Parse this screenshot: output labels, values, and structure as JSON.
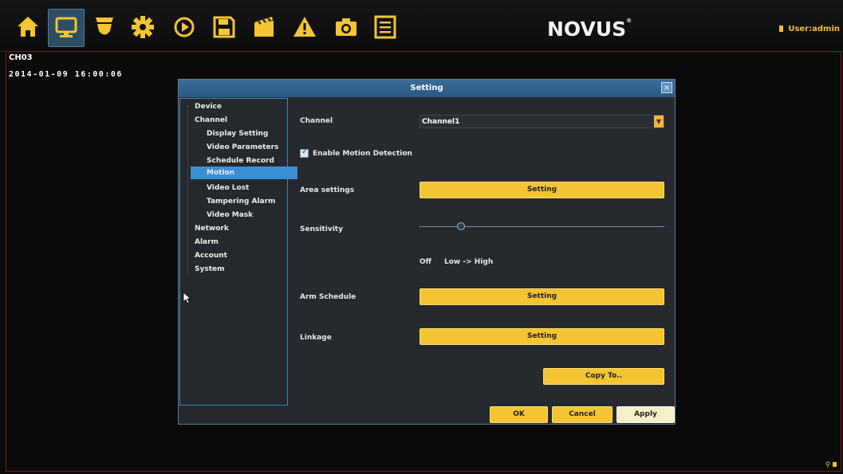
{
  "toolbar": {
    "icons": [
      "home-icon",
      "monitor-icon",
      "camera-icon",
      "gear-icon",
      "play-icon",
      "save-icon",
      "clapper-icon",
      "warning-icon",
      "photo-camera-icon",
      "log-icon"
    ],
    "active_index": 1
  },
  "brand": {
    "name": "NOVUS"
  },
  "user": {
    "label": "User:admin"
  },
  "video": {
    "channel": "CH03",
    "timestamp": "2014-01-09 16:00:06"
  },
  "dialog": {
    "title": "Setting",
    "close": "×",
    "tree": {
      "device": "Device",
      "channel": "Channel",
      "display_setting": "Display Setting",
      "video_parameters": "Video Parameters",
      "schedule_record": "Schedule Record",
      "motion": "Motion",
      "video_lost": "Video Lost",
      "tampering_alarm": "Tampering Alarm",
      "video_mask": "Video Mask",
      "network": "Network",
      "alarm": "Alarm",
      "account": "Account",
      "system": "System"
    },
    "form": {
      "channel_label": "Channel",
      "channel_value": "Channel1",
      "enable_motion_label": "Enable Motion Detection",
      "enable_motion_checked": true,
      "area_label": "Area settings",
      "area_button": "Setting",
      "sensitivity_label": "Sensitivity",
      "sensitivity_value": 0.17,
      "off_label": "Off",
      "range_label": "Low -> High",
      "arm_label": "Arm Schedule",
      "arm_button": "Setting",
      "linkage_label": "Linkage",
      "linkage_button": "Setting",
      "copy_button": "Copy To.."
    },
    "buttons": {
      "ok": "OK",
      "cancel": "Cancel",
      "apply": "Apply"
    }
  },
  "colors": {
    "accent": "#f4c433",
    "selected": "#3b8fd3",
    "border": "#8a1a1a"
  }
}
